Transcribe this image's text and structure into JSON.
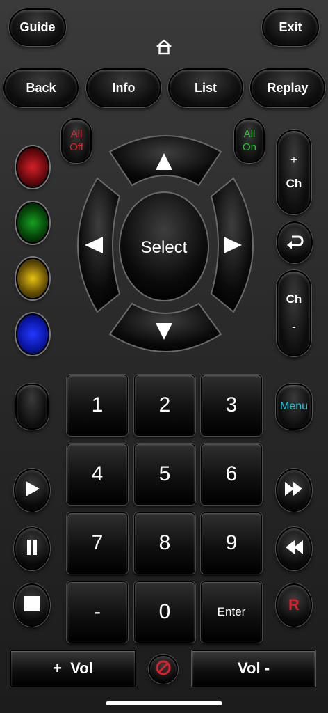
{
  "top": {
    "guide": "Guide",
    "exit": "Exit"
  },
  "row2": {
    "back": "Back",
    "info": "Info",
    "list": "List",
    "replay": "Replay"
  },
  "power": {
    "all_off_line1": "All",
    "all_off_line2": "Off",
    "all_on_line1": "All",
    "all_on_line2": "On"
  },
  "dpad": {
    "select": "Select"
  },
  "channel": {
    "up_symbol": "+",
    "up_label": "Ch",
    "down_label": "Ch",
    "down_symbol": "-"
  },
  "keypad": [
    "1",
    "2",
    "3",
    "4",
    "5",
    "6",
    "7",
    "8",
    "9",
    "-",
    "0",
    "Enter"
  ],
  "menu": "Menu",
  "record": "R",
  "volume": {
    "up": "+  Vol",
    "down": "Vol -"
  },
  "colors": {
    "red": "#c4121c",
    "green": "#0d8a16",
    "yellow": "#c9a60c",
    "blue": "#0a1fd6",
    "all_off": "#e0202c",
    "all_on": "#27c531",
    "menu": "#1ec0d8",
    "record": "#d8202c"
  }
}
